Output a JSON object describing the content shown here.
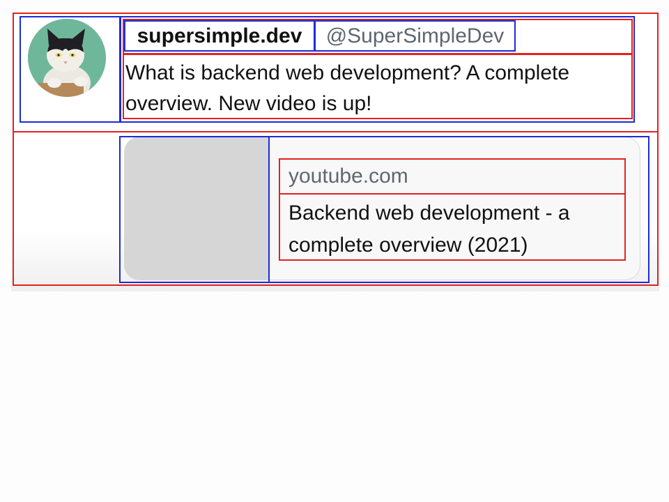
{
  "tweet": {
    "author_name": "supersimple.dev",
    "handle": "@SuperSimpleDev",
    "text": "What is backend web development? A complete overview. New video is up!",
    "avatar_icon": "cat-avatar-icon"
  },
  "link_preview": {
    "domain": "youtube.com",
    "title": "Backend web development - a complete overview (2021)"
  },
  "colors": {
    "outline_red": "#e32020",
    "outline_blue": "#1c2bd6",
    "muted_text": "#5e6670",
    "thumbnail_placeholder": "#d6d6d6"
  }
}
